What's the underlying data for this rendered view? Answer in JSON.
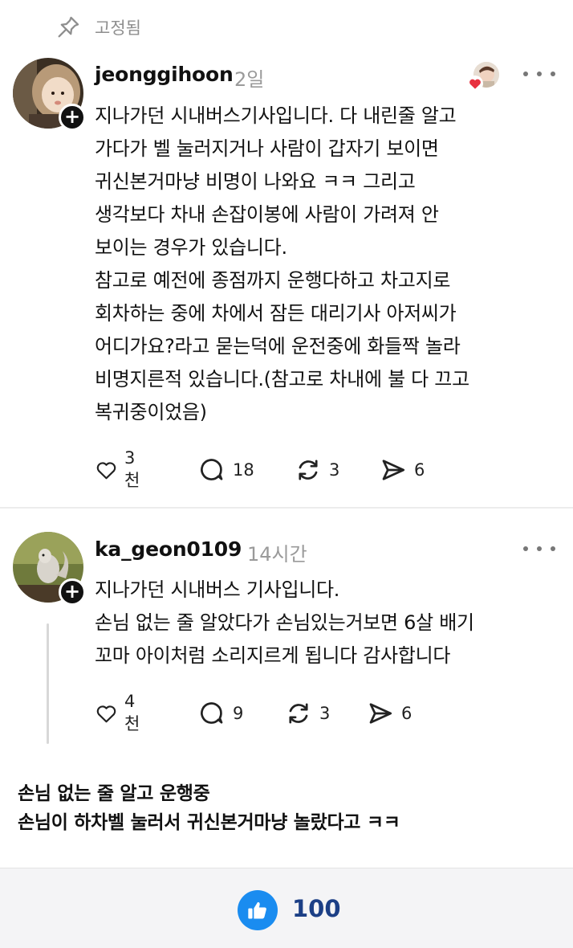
{
  "pinned": {
    "icon": "pin-icon",
    "label": "고정됨"
  },
  "posts": [
    {
      "username": "jeonggihoon",
      "time": "2일",
      "lines": [
        "지나가던 시내버스기사입니다. 다 내린줄 알고",
        "가다가 벨 눌러지거나 사람이 갑자기 보이면",
        "귀신본거마냥 비명이 나와요 ㅋㅋ 그리고",
        "생각보다 차내 손잡이봉에 사람이 가려져 안",
        "보이는 경우가 있습니다.",
        "참고로 예전에 종점까지 운행다하고 차고지로",
        "회차하는 중에 차에서 잠든 대리기사 아저씨가",
        "어디가요?라고 묻는덕에 운전중에 화들짝 놀라",
        "비명지른적 있습니다.(참고로 차내에 불 다 끄고",
        "복귀중이었음)"
      ],
      "likes": "3천",
      "comments": "18",
      "reposts": "3",
      "shares": "6"
    },
    {
      "username": "ka_geon0109",
      "time": "14시간",
      "lines": [
        "지나가던 시내버스 기사입니다.",
        "손님 없는 줄 알았다가 손님있는거보면 6살 배기",
        "꼬마 아이처럼 소리지르게 됩니다 감사합니다"
      ],
      "likes": "4천",
      "comments": "9",
      "reposts": "3",
      "shares": "6"
    }
  ],
  "caption": [
    "손님 없는 줄 알고 운행중",
    "손님이 하차벨 눌러서 귀신본거마냥 놀랐다고 ㅋㅋ"
  ],
  "footer": {
    "like_count": "100"
  },
  "colors": {
    "accent": "#1a8cf0",
    "count": "#1c3f86",
    "muted": "#9a9a9a",
    "heart": "#e8313f"
  }
}
